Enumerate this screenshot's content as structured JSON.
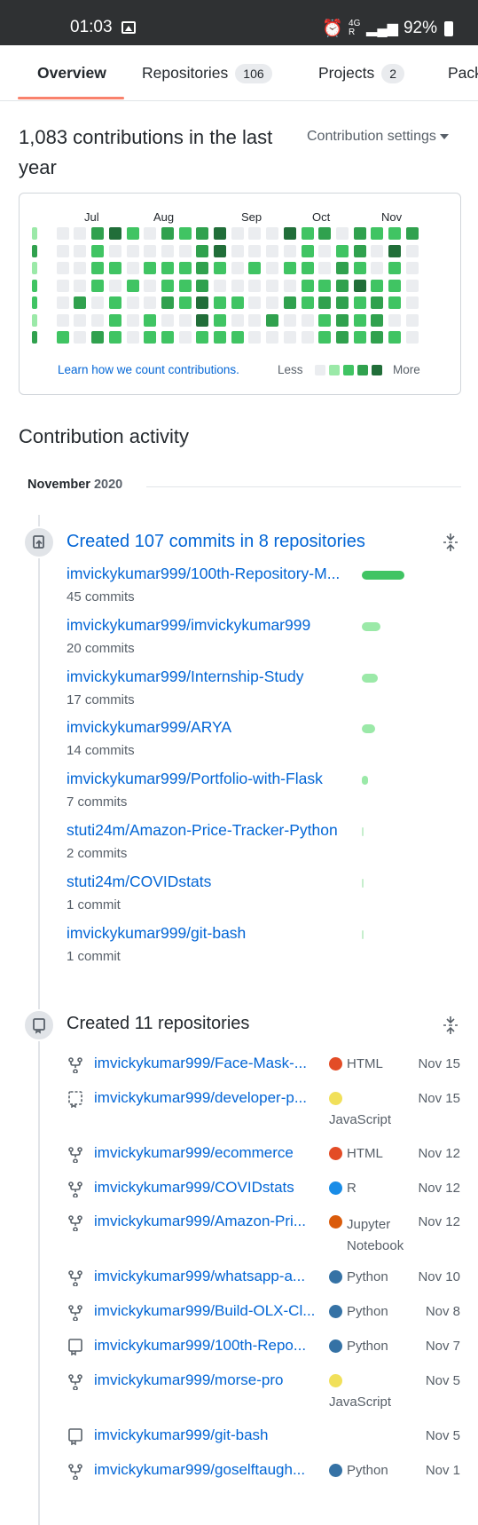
{
  "status_bar": {
    "time": "01:03",
    "network_top": "4G",
    "network_sub": "R",
    "battery": "92%"
  },
  "tabs": [
    {
      "label": "Overview",
      "count": null
    },
    {
      "label": "Repositories",
      "count": "106"
    },
    {
      "label": "Projects",
      "count": "2"
    },
    {
      "label": "Pack",
      "count": null
    }
  ],
  "contributions": {
    "title": "1,083 contributions in the last year",
    "settings_label": "Contribution settings",
    "months": [
      "Jul",
      "Aug",
      "Sep",
      "Oct",
      "Nov"
    ],
    "learn_link": "Learn how we count contributions.",
    "legend_less": "Less",
    "legend_more": "More",
    "levels_colors": [
      "#ebedf0",
      "#9be9a8",
      "#40c463",
      "#30a14e",
      "#216e39"
    ],
    "grid": [
      [
        1,
        0,
        0,
        3,
        4,
        2,
        0,
        3,
        2,
        3,
        4,
        0,
        0,
        0,
        4,
        2,
        3,
        0,
        3,
        2,
        2,
        3
      ],
      [
        3,
        0,
        0,
        2,
        0,
        0,
        0,
        0,
        0,
        3,
        4,
        0,
        0,
        0,
        0,
        2,
        0,
        2,
        3,
        0,
        4,
        0
      ],
      [
        1,
        0,
        0,
        2,
        2,
        0,
        2,
        2,
        2,
        3,
        2,
        0,
        2,
        0,
        2,
        2,
        0,
        3,
        2,
        0,
        2,
        0
      ],
      [
        2,
        0,
        0,
        2,
        0,
        2,
        0,
        2,
        2,
        3,
        0,
        0,
        0,
        0,
        0,
        2,
        2,
        3,
        4,
        2,
        2,
        0
      ],
      [
        2,
        0,
        3,
        0,
        2,
        0,
        0,
        3,
        2,
        4,
        2,
        2,
        0,
        0,
        3,
        2,
        3,
        3,
        2,
        3,
        2,
        0
      ],
      [
        1,
        0,
        0,
        0,
        2,
        0,
        2,
        0,
        0,
        4,
        2,
        0,
        0,
        3,
        0,
        0,
        2,
        3,
        2,
        3,
        0,
        0
      ],
      [
        3,
        2,
        0,
        3,
        2,
        0,
        2,
        2,
        0,
        2,
        2,
        2,
        0,
        0,
        0,
        0,
        2,
        3,
        2,
        3,
        2,
        0
      ]
    ]
  },
  "activity": {
    "title": "Contribution activity",
    "month": "November",
    "year": "2020",
    "commits_event": {
      "title": "Created 107 commits in 8 repositories",
      "repos": [
        {
          "name": "imvickykumar999/100th-Repository-M...",
          "count": "45 commits",
          "value": 45
        },
        {
          "name": "imvickykumar999/imvickykumar999",
          "count": "20 commits",
          "value": 20
        },
        {
          "name": "imvickykumar999/Internship-Study",
          "count": "17 commits",
          "value": 17
        },
        {
          "name": "imvickykumar999/ARYA",
          "count": "14 commits",
          "value": 14
        },
        {
          "name": "imvickykumar999/Portfolio-with-Flask",
          "count": "7 commits",
          "value": 7
        },
        {
          "name": "stuti24m/Amazon-Price-Tracker-Python",
          "count": "2 commits",
          "value": 2
        },
        {
          "name": "stuti24m/COVIDstats",
          "count": "1 commit",
          "value": 1
        },
        {
          "name": "imvickykumar999/git-bash",
          "count": "1 commit",
          "value": 1
        }
      ]
    },
    "repos_event": {
      "title": "Created 11 repositories",
      "repos": [
        {
          "icon": "fork-icon",
          "name": "imvickykumar999/Face-Mask-...",
          "lang": "HTML",
          "color": "#e34c26",
          "date": "Nov 15",
          "wrap": false
        },
        {
          "icon": "template-icon",
          "name": "imvickykumar999/developer-p...",
          "lang": "JavaScript",
          "color": "#f1e05a",
          "date": "Nov 15",
          "wrap": true
        },
        {
          "icon": "fork-icon",
          "name": "imvickykumar999/ecommerce",
          "lang": "HTML",
          "color": "#e34c26",
          "date": "Nov 12",
          "wrap": false
        },
        {
          "icon": "fork-icon",
          "name": "imvickykumar999/COVIDstats",
          "lang": "R",
          "color": "#198ce7",
          "date": "Nov 12",
          "wrap": false
        },
        {
          "icon": "fork-icon",
          "name": "imvickykumar999/Amazon-Pri...",
          "lang": "Jupyter Notebook",
          "color": "#DA5B0B",
          "date": "Nov 12",
          "wrap": true
        },
        {
          "icon": "fork-icon",
          "name": "imvickykumar999/whatsapp-a...",
          "lang": "Python",
          "color": "#3572A5",
          "date": "Nov 10",
          "wrap": false
        },
        {
          "icon": "fork-icon",
          "name": "imvickykumar999/Build-OLX-Cl...",
          "lang": "Python",
          "color": "#3572A5",
          "date": "Nov 8",
          "wrap": false
        },
        {
          "icon": "repo-icon",
          "name": "imvickykumar999/100th-Repo...",
          "lang": "Python",
          "color": "#3572A5",
          "date": "Nov 7",
          "wrap": false
        },
        {
          "icon": "fork-icon",
          "name": "imvickykumar999/morse-pro",
          "lang": "JavaScript",
          "color": "#f1e05a",
          "date": "Nov 5",
          "wrap": true
        },
        {
          "icon": "repo-icon",
          "name": "imvickykumar999/git-bash",
          "lang": "",
          "color": "",
          "date": "Nov 5",
          "wrap": false
        },
        {
          "icon": "fork-icon",
          "name": "imvickykumar999/goselftaugh...",
          "lang": "Python",
          "color": "#3572A5",
          "date": "Nov 1",
          "wrap": false
        }
      ]
    }
  }
}
